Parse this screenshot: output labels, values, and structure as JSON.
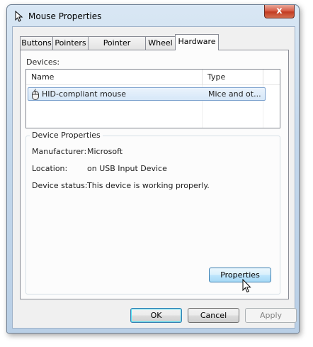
{
  "window": {
    "title": "Mouse Properties",
    "close_glyph": "x"
  },
  "tabs": [
    {
      "label": "Buttons"
    },
    {
      "label": "Pointers"
    },
    {
      "label": "Pointer Options"
    },
    {
      "label": "Wheel"
    },
    {
      "label": "Hardware"
    }
  ],
  "active_tab": "Hardware",
  "devices": {
    "label": "Devices:",
    "columns": {
      "name": "Name",
      "type": "Type"
    },
    "rows": [
      {
        "name": "HID-compliant mouse",
        "type": "Mice and ot..."
      }
    ]
  },
  "device_properties": {
    "title": "Device Properties",
    "manufacturer_label": "Manufacturer:",
    "manufacturer_value": "Microsoft",
    "location_label": "Location:",
    "location_value": "on USB Input Device",
    "status_label": "Device status:",
    "status_value": "This device is working properly.",
    "properties_button": "Properties"
  },
  "footer": {
    "ok": "OK",
    "cancel": "Cancel",
    "apply": "Apply"
  },
  "icons": {
    "title": "mouse-pointer-icon",
    "row": "mouse-device-icon",
    "cursor": "arrow-cursor-icon"
  },
  "colors": {
    "selection": "#d6e7f8",
    "close_button": "#c23b22",
    "focus_border": "#3c7fb1"
  }
}
